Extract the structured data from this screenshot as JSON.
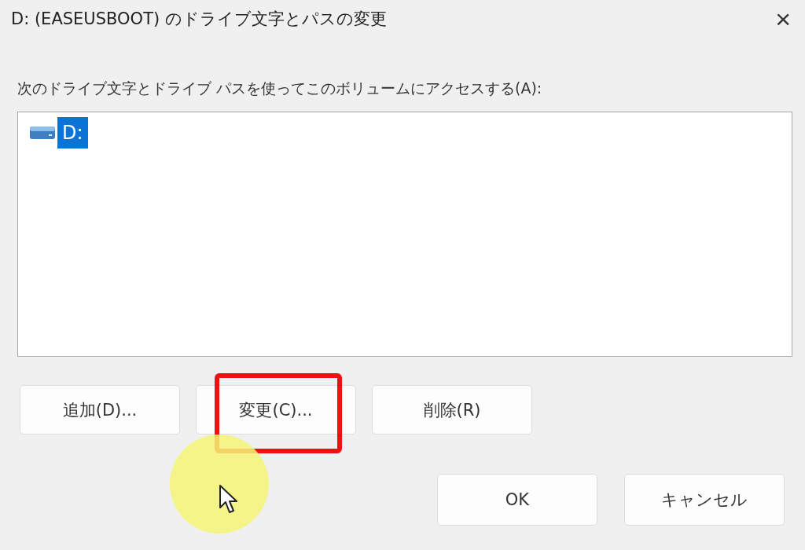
{
  "window": {
    "title": "D: (EASEUSBOOT) のドライブ文字とパスの変更",
    "close": "×"
  },
  "list_label": "次のドライブ文字とドライブ パスを使ってこのボリュームにアクセスする(A):",
  "list_items": [
    {
      "label": "D:",
      "selected": true
    }
  ],
  "action_buttons": [
    {
      "label": "追加(D)...",
      "highlighted": false
    },
    {
      "label": "変更(C)...",
      "highlighted": true
    },
    {
      "label": "削除(R)",
      "highlighted": false
    }
  ],
  "dialog_buttons": [
    "OK",
    "キャンセル"
  ]
}
